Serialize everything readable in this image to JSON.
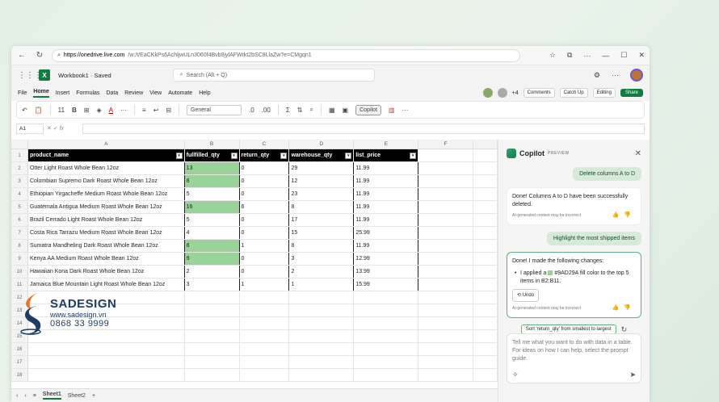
{
  "browser": {
    "url_host": "https://onedrive.live.com",
    "url_rest": "/w:/t/EaCKkPs6AchljwULn3060f4Bvb8jylAFWrkt2bSC8LlaZw?e=CMgqn1"
  },
  "app": {
    "workbook_title": "Workbook1 · Saved",
    "search_placeholder": "Search (Alt + Q)",
    "presence_count": "+4"
  },
  "menu": {
    "items": [
      "File",
      "Home",
      "Insert",
      "Formulas",
      "Data",
      "Review",
      "View",
      "Automate",
      "Help"
    ],
    "comments": "Comments",
    "catchup": "Catch Up",
    "editing": "Editing",
    "share": "Share"
  },
  "ribbon": {
    "font_size": "11",
    "bold": "B",
    "number_format": "General",
    "copilot": "Copilot"
  },
  "formula": {
    "namebox": "A1",
    "fx": "fx"
  },
  "grid": {
    "columns": [
      "A",
      "B",
      "C",
      "D",
      "E",
      "F"
    ],
    "headers": [
      "product_name",
      "fullfilled_qty",
      "return_qty",
      "warehouse_qty",
      "list_price"
    ],
    "rows": [
      [
        "Otter Light Roast Whole Bean 12oz",
        "13",
        "0",
        "29",
        "11.99"
      ],
      [
        "Colombian Supremo Dark Roast Whole Bean 12oz",
        "8",
        "0",
        "12",
        "11.99"
      ],
      [
        "Ethiopian Yirgacheffe Medium Roast Whole Bean 12oz",
        "5",
        "0",
        "23",
        "11.99"
      ],
      [
        "Guatemala Antigua Medium Roast Whole Bean 12oz",
        "16",
        "6",
        "8",
        "11.99"
      ],
      [
        "Brazil Cerrado Light Roast Whole Bean 12oz",
        "5",
        "0",
        "17",
        "11.99"
      ],
      [
        "Costa Rica Tarrazu Medium Roast Whole Bean 12oz",
        "4",
        "0",
        "15",
        "25.99"
      ],
      [
        "Sumatra Mandheling Dark Roast Whole Bean 12oz",
        "8",
        "1",
        "8",
        "11.99"
      ],
      [
        "Kenya AA Medium Roast Whole Bean 12oz",
        "9",
        "0",
        "3",
        "12.99"
      ],
      [
        "Hawaiian Kona Dark Roast Whole Bean 12oz",
        "2",
        "0",
        "2",
        "13.99"
      ],
      [
        "Jamaica Blue Mountain Light Roast Whole Bean 12oz",
        "3",
        "1",
        "1",
        "15.99"
      ]
    ],
    "highlighted_rows": [
      0,
      1,
      3,
      6,
      7
    ],
    "highlight_color": "#9AD29A",
    "row_numbers": [
      "1",
      "2",
      "3",
      "4",
      "5",
      "6",
      "7",
      "8",
      "9",
      "10",
      "11",
      "12",
      "13",
      "14",
      "15",
      "16",
      "17",
      "18"
    ]
  },
  "sheets": {
    "tabs": [
      "Sheet1",
      "Sheet2"
    ],
    "add": "+"
  },
  "watermark": {
    "title": "SADESIGN",
    "url": "www.sadesign.vn",
    "phone": "0868 33 9999"
  },
  "copilot": {
    "title": "Copilot",
    "badge": "PREVIEW",
    "msg1_user": "Delete columns A to D",
    "msg1_reply": "Done! Columns A to D have been successfully deleted.",
    "disclaimer": "AI-generated content may be incorrect",
    "msg2_user": "Highlight the most shipped items",
    "msg2_reply": "Done! I made the following changes:",
    "msg2_bullet_a": "I applied a",
    "msg2_bullet_b": "#9AD29A fill color to the top 5 items in B2:B11.",
    "undo": "Undo",
    "suggestion": "Sort 'return_qty' from smallest to largest",
    "input_placeholder": "Tell me what you want to do with data in a table. For ideas on how I can help, select the prompt guide."
  }
}
